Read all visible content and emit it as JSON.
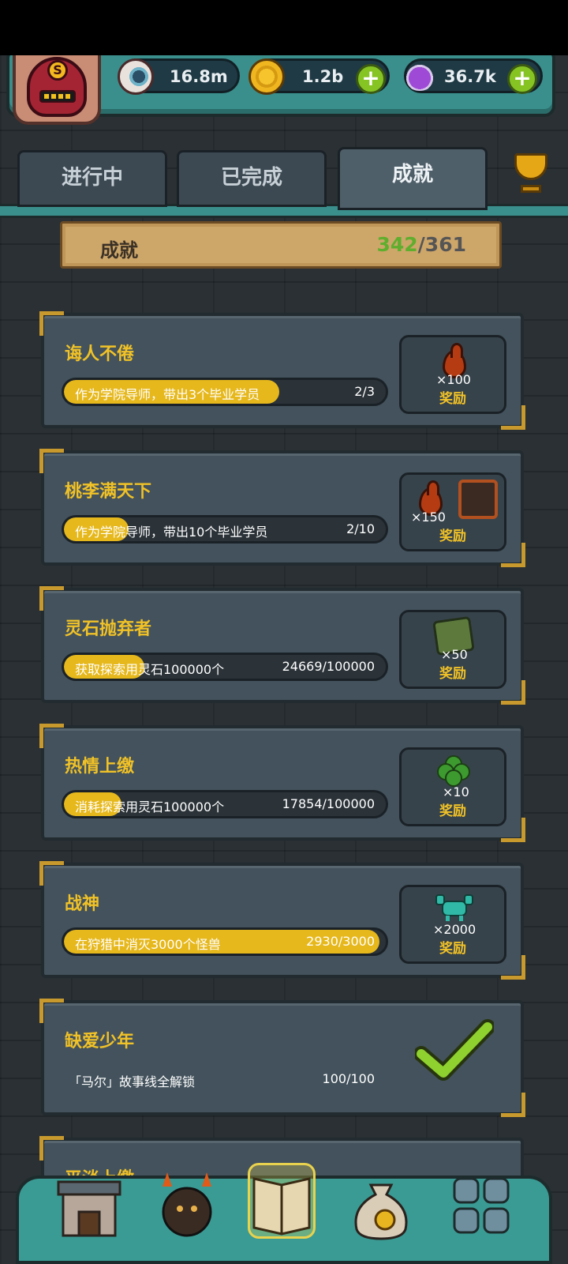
{
  "resources": {
    "eyeball": {
      "icon": "eyeball-icon",
      "value": "16.8m"
    },
    "coin": {
      "icon": "gold-coin-icon",
      "value": "1.2b"
    },
    "potion": {
      "icon": "potion-icon",
      "value": "36.7k"
    }
  },
  "tabs": [
    {
      "label": "进行中",
      "active": false
    },
    {
      "label": "已完成",
      "active": false
    },
    {
      "label": "成就",
      "active": true
    }
  ],
  "summary": {
    "label": "成就",
    "done": "342",
    "sep_total": "/361"
  },
  "achievements": [
    {
      "title": "诲人不倦",
      "desc": "作为学院导师，带出3个毕业学员",
      "progress_text": "2/3",
      "progress": 0.67,
      "reward_qty": "×100",
      "reward_label": "奖励",
      "reward_icon": "blood-drop-icon"
    },
    {
      "title": "桃李满天下",
      "desc": "作为学院导师，带出10个毕业学员",
      "progress_text": "2/10",
      "progress": 0.2,
      "reward_qty": "×150",
      "reward_label": "奖励",
      "reward_icon": "blood-drop-icon"
    },
    {
      "title": "灵石抛弃者",
      "desc": "获取探索用灵石100000个",
      "progress_text": "24669/100000",
      "progress": 0.25,
      "reward_qty": "×50",
      "reward_label": "奖励",
      "reward_icon": "spirit-stone-icon"
    },
    {
      "title": "热情上缴",
      "desc": "消耗探索用灵石100000个",
      "progress_text": "17854/100000",
      "progress": 0.18,
      "reward_qty": "×10",
      "reward_label": "奖励",
      "reward_icon": "clover-icon"
    },
    {
      "title": "战神",
      "desc": "在狩猎中消灭3000个怪兽",
      "progress_text": "2930/3000",
      "progress": 0.98,
      "reward_qty": "×2000",
      "reward_label": "奖励",
      "reward_icon": "crab-monster-icon"
    },
    {
      "title": "缺爱少年",
      "desc": "「马尔」故事线全解锁",
      "progress_text": "100/100",
      "progress": 1.0,
      "completed": true
    },
    {
      "title": "平淡上缴"
    }
  ],
  "bottom_nav": [
    "shop-building-icon",
    "monster-altar-icon",
    "book-icon",
    "money-bag-icon",
    "grid-monsters-icon"
  ]
}
